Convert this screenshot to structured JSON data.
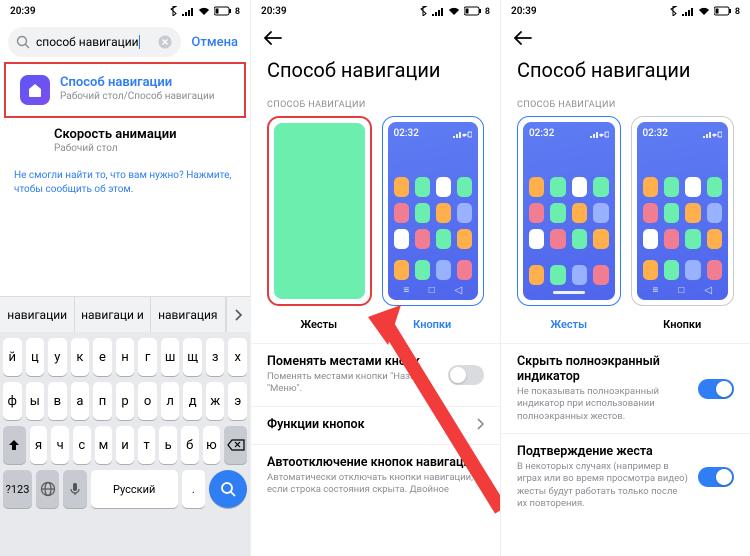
{
  "status": {
    "time": "20:39",
    "battery": "8"
  },
  "screen1": {
    "search_value": "способ навигации",
    "cancel": "Отмена",
    "result1": {
      "title": "Способ навигации",
      "sub": "Рабочий стол/Способ навигации"
    },
    "result2": {
      "title": "Скорость анимации",
      "sub": "Рабочий стол"
    },
    "help": "Не смогли найти то, что вам нужно? Нажмите, чтобы сообщить об этом.",
    "suggestions": [
      "навигации",
      "навигаци и",
      "навигация"
    ],
    "row1": [
      "й",
      "ц",
      "у",
      "к",
      "е",
      "н",
      "г",
      "ш",
      "щ",
      "з",
      "х"
    ],
    "row2": [
      "ф",
      "ы",
      "в",
      "а",
      "п",
      "р",
      "о",
      "л",
      "д",
      "ж",
      "э"
    ],
    "row3": [
      "я",
      "ч",
      "с",
      "м",
      "и",
      "т",
      "ь",
      "б",
      "ю"
    ],
    "row4_num": "?123",
    "row4_lang": "Русский",
    "row4_dot": "."
  },
  "screen2": {
    "title": "Способ навигации",
    "section": "СПОСОБ НАВИГАЦИИ",
    "label_gestures": "Жесты",
    "label_buttons": "Кнопки",
    "mini_time": "02:32",
    "s1_title": "Поменять местами кнопк",
    "s1_sub": "Поменять местами кнопки \"Назад\" \"Меню\".",
    "s2_title": "Функции кнопок",
    "s3_title": "Автоотключение кнопок навигации",
    "s3_sub": "Автоматически отключать кнопки навигации, если строка состояния скрыта. Двойное"
  },
  "screen3": {
    "title": "Способ навигации",
    "section": "СПОСОБ НАВИГАЦИИ",
    "label_gestures": "Жесты",
    "label_buttons": "Кнопки",
    "mini_time": "02:32",
    "s1_title": "Скрыть полноэкранный индикатор",
    "s1_sub": "Не показывать полноэкранный индикатор при использовании полноэкранных жестов.",
    "s2_title": "Подтверждение жеста",
    "s2_sub": "В некоторых случаях (например в играх или во время просмотра видео) жесты будут работать только после их повторения."
  },
  "colors": {
    "apps": [
      "#ffb04c",
      "#6ceeae",
      "#ffffff",
      "#6ceeae",
      "#f07d92",
      "#6ceeae",
      "#ffb04c",
      "#99b2ff",
      "#ffffff",
      "#f07d92",
      "#6ceeae",
      "#ffb04c"
    ],
    "dock": [
      "#ffb04c",
      "#6ceeae",
      "#99b2ff",
      "#f07d92"
    ]
  }
}
